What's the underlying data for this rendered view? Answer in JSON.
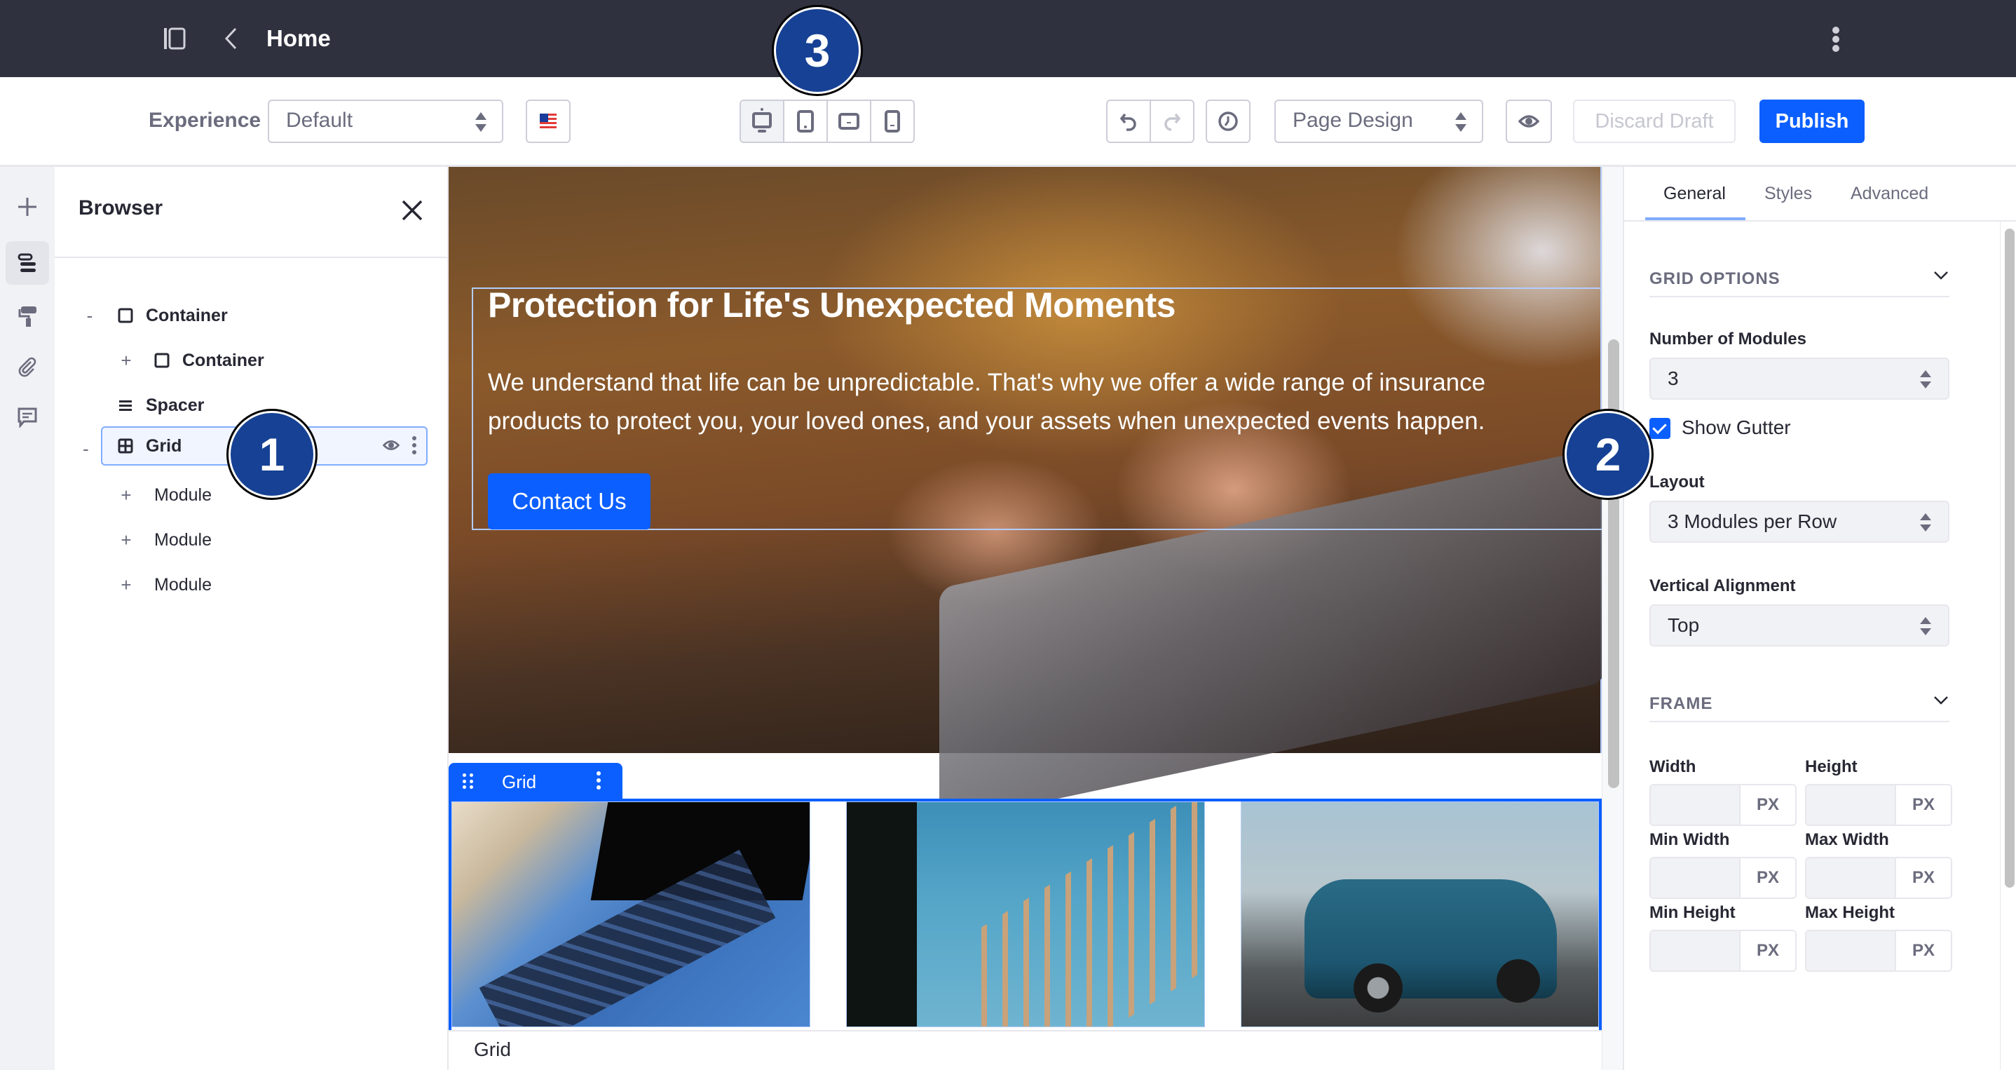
{
  "topbar": {
    "title": "Home",
    "icons": {
      "sidebar_toggle": "sidebar-panel-icon",
      "back": "chevron-left-icon",
      "menu": "kebab-vertical-icon"
    }
  },
  "toolbar": {
    "experience_label": "Experience",
    "experience_value": "Default",
    "language_flag": "en-US",
    "devices": [
      {
        "name": "desktop",
        "active": true
      },
      {
        "name": "tablet",
        "active": false
      },
      {
        "name": "landscape-phone",
        "active": false
      },
      {
        "name": "portrait-phone",
        "active": false
      }
    ],
    "undo": {
      "enabled": true
    },
    "redo": {
      "enabled": false
    },
    "mode_value": "Page Design",
    "discard_label": "Discard Draft",
    "discard_enabled": false,
    "publish_label": "Publish"
  },
  "rail": {
    "items": [
      {
        "name": "add",
        "active": false
      },
      {
        "name": "browser",
        "active": true
      },
      {
        "name": "page-design-options",
        "active": false
      },
      {
        "name": "mapping",
        "active": false
      },
      {
        "name": "comments",
        "active": false
      }
    ]
  },
  "browser": {
    "title": "Browser",
    "tree": [
      {
        "label": "Container",
        "toggle": "-",
        "icon": "container-icon",
        "level": 0
      },
      {
        "label": "Container",
        "toggle": "+",
        "icon": "container-icon",
        "level": 1
      },
      {
        "label": "Spacer",
        "toggle": "",
        "icon": "spacer-icon",
        "level": 0
      },
      {
        "label": "Grid",
        "toggle": "-",
        "icon": "grid-icon",
        "level": 0,
        "selected": true
      },
      {
        "label": "Module",
        "toggle": "+",
        "icon": "",
        "level": 1
      },
      {
        "label": "Module",
        "toggle": "+",
        "icon": "",
        "level": 1
      },
      {
        "label": "Module",
        "toggle": "+",
        "icon": "",
        "level": 1
      }
    ]
  },
  "canvas": {
    "hero_heading": "Protection for Life's Unexpected Moments",
    "hero_body": "We understand that life can be unpredictable. That's why we offer a wide range of insurance products to protect you, your loved ones, and your assets when unexpected events happen.",
    "cta_label": "Contact Us",
    "grid_tab_label": "Grid",
    "modules": [
      {
        "image": "laptop-keyboard-photo"
      },
      {
        "image": "construction-worker-photo"
      },
      {
        "image": "blue-car-photo"
      }
    ],
    "footer_label": "Grid"
  },
  "config": {
    "tabs": [
      "General",
      "Styles",
      "Advanced"
    ],
    "active_tab": "General",
    "grid_options_title": "GRID OPTIONS",
    "number_of_modules_label": "Number of Modules",
    "number_of_modules_value": "3",
    "show_gutter_label": "Show Gutter",
    "show_gutter_checked": true,
    "layout_label": "Layout",
    "layout_value": "3 Modules per Row",
    "vertical_alignment_label": "Vertical Alignment",
    "vertical_alignment_value": "Top",
    "frame_title": "FRAME",
    "frame_fields": [
      {
        "label": "Width",
        "value": "",
        "unit": "PX"
      },
      {
        "label": "Height",
        "value": "",
        "unit": "PX"
      },
      {
        "label": "Min Width",
        "value": "",
        "unit": "PX"
      },
      {
        "label": "Max Width",
        "value": "",
        "unit": "PX"
      },
      {
        "label": "Min Height",
        "value": "",
        "unit": "PX"
      },
      {
        "label": "Max Height",
        "value": "",
        "unit": "PX"
      }
    ]
  },
  "callouts": [
    "1",
    "2",
    "3"
  ],
  "colors": {
    "topbar_bg": "#30313f",
    "primary": "#0b5fff",
    "callout": "#164194",
    "selection_border": "#80acff"
  }
}
